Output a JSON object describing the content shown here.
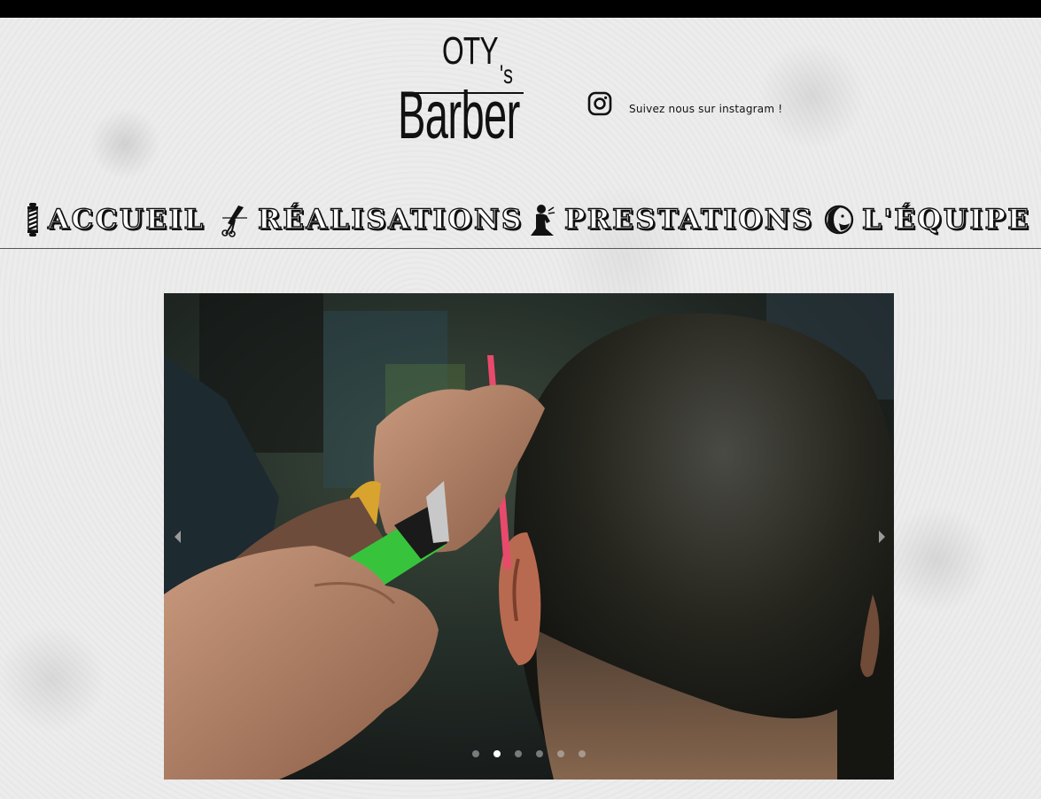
{
  "brand": {
    "logo_line1": "OTY",
    "logo_apostrophe_s": "'s",
    "logo_line2": "Barber"
  },
  "social": {
    "icon": "instagram-icon",
    "text": "Suivez nous sur instagram !"
  },
  "nav": {
    "items": [
      {
        "label": "ACCUEIL",
        "icon": "barber-pole-icon"
      },
      {
        "label": "RÉALISATIONS",
        "icon": "scissors-comb-icon"
      },
      {
        "label": "PRESTATIONS",
        "icon": "barber-silhouette-icon"
      },
      {
        "label": "L'ÉQUIPE",
        "icon": "team-face-icon"
      }
    ]
  },
  "slideshow": {
    "image": "barber-cutting-hair-photo",
    "slide_count": 6,
    "active_slide": 2,
    "prev_icon": "chevron-left-icon",
    "next_icon": "chevron-right-icon"
  },
  "colors": {
    "topbar": "#000000",
    "background": "#ececec",
    "nav_text": "#ffffff",
    "nav_outline": "#111111",
    "comb": "#e84a6b",
    "clipper": "#3fc43a"
  }
}
